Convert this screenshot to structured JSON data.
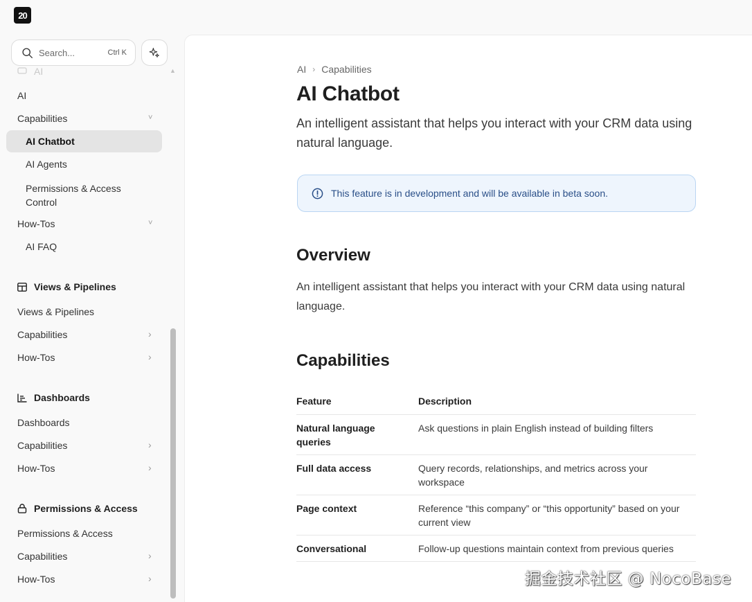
{
  "logo": "20",
  "search": {
    "placeholder": "Search...",
    "shortcut": "Ctrl K"
  },
  "sidebar": {
    "faded_item": "AI",
    "ai_group": {
      "items": [
        {
          "label": "AI"
        },
        {
          "label": "Capabilities",
          "chevron": "˅"
        },
        {
          "label": "AI Chatbot",
          "active": true
        },
        {
          "label": "AI Agents"
        },
        {
          "label": "Permissions & Access Control"
        },
        {
          "label": "How-Tos",
          "chevron": "˅"
        },
        {
          "label": "AI FAQ"
        }
      ]
    },
    "sections": [
      {
        "title": "Views & Pipelines",
        "icon": "table-icon",
        "items": [
          "Views & Pipelines",
          "Capabilities",
          "How-Tos"
        ]
      },
      {
        "title": "Dashboards",
        "icon": "chart-icon",
        "items": [
          "Dashboards",
          "Capabilities",
          "How-Tos"
        ]
      },
      {
        "title": "Permissions & Access",
        "icon": "lock-icon",
        "items": [
          "Permissions & Access",
          "Capabilities",
          "How-Tos"
        ]
      }
    ],
    "chevron_right": "›"
  },
  "breadcrumb": {
    "items": [
      "AI",
      "Capabilities"
    ],
    "separator": "›"
  },
  "page": {
    "title": "AI Chatbot",
    "lead": "An intelligent assistant that helps you interact with your CRM data using natural language.",
    "callout": "This feature is in development and will be available in beta soon.",
    "overview_heading": "Overview",
    "overview_text": "An intelligent assistant that helps you interact with your CRM data using natural language.",
    "capabilities_heading": "Capabilities"
  },
  "table": {
    "headers": [
      "Feature",
      "Description"
    ],
    "rows": [
      [
        "Natural language queries",
        "Ask questions in plain English instead of building filters"
      ],
      [
        "Full data access",
        "Query records, relationships, and metrics across your workspace"
      ],
      [
        "Page context",
        "Reference “this company” or “this opportunity” based on your current view"
      ],
      [
        "Conversational",
        "Follow-up questions maintain context from previous queries"
      ]
    ]
  },
  "watermark": "掘金技术社区 @ NocoBase"
}
